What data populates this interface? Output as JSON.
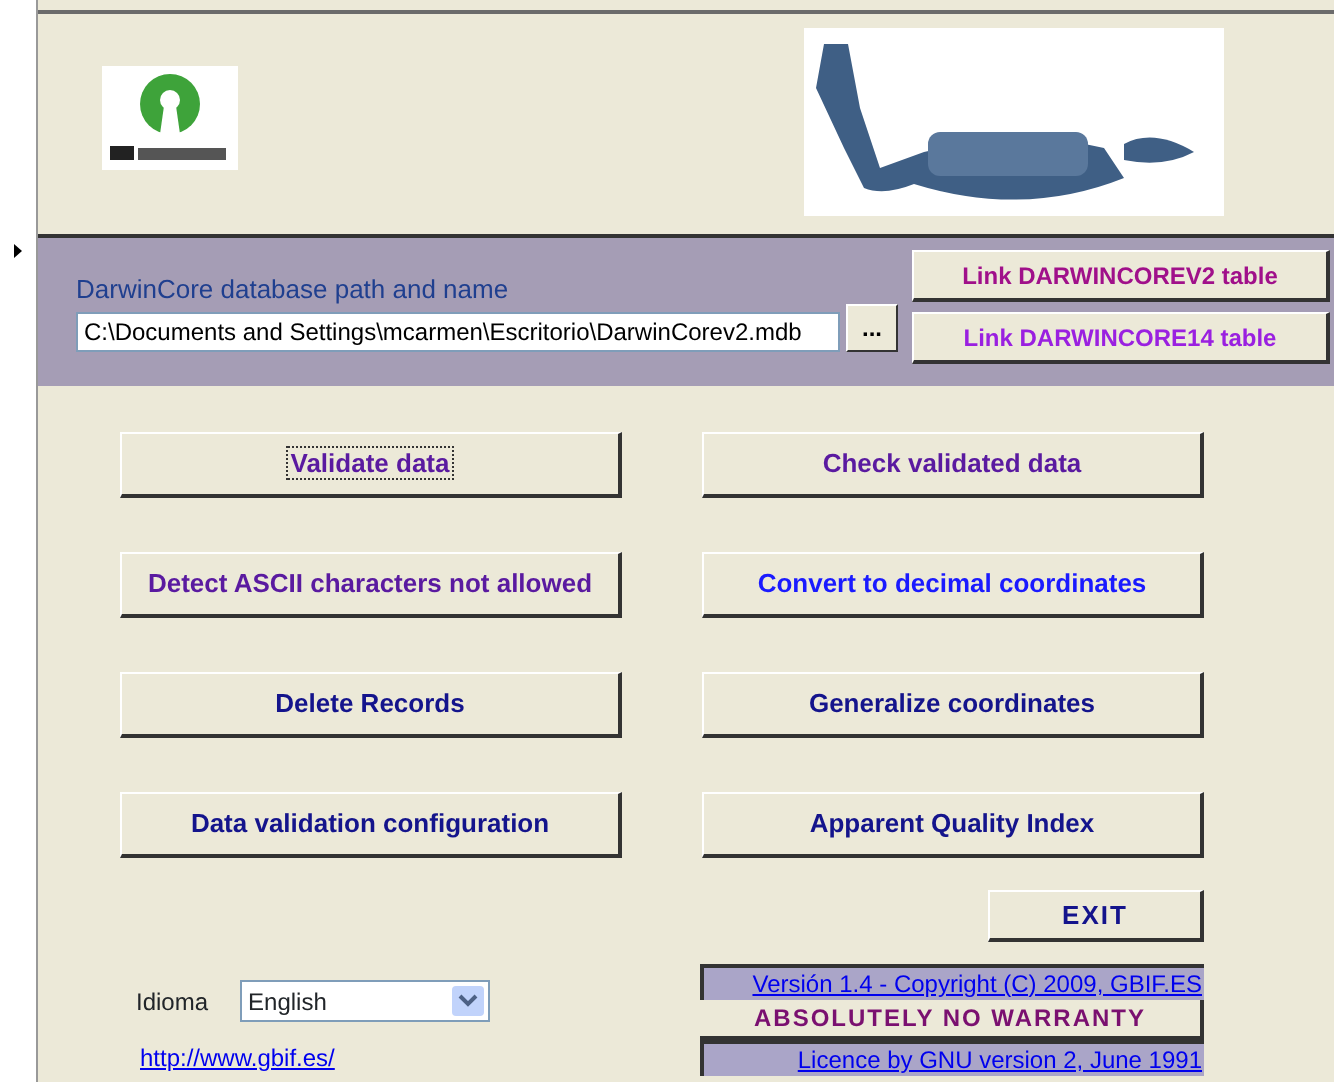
{
  "database": {
    "label": "DarwinCore database path and name",
    "path": "C:\\Documents and Settings\\mcarmen\\Escritorio\\DarwinCorev2.mdb",
    "browse": "..."
  },
  "link_buttons": [
    {
      "label": "Link DARWINCOREV2 table",
      "color": "#a0108a"
    },
    {
      "label": "Link DARWINCORE14 table",
      "color": "#9a20e0"
    }
  ],
  "actions": [
    {
      "label": "Validate data",
      "color": "#5a1aa0",
      "focused": true
    },
    {
      "label": "Check validated data",
      "color": "#5a1aa0",
      "focused": false
    },
    {
      "label": "Detect ASCII characters not allowed",
      "color": "#5a1aa0",
      "focused": false
    },
    {
      "label": "Convert to decimal coordinates",
      "color": "#1a1aff",
      "focused": false
    },
    {
      "label": "Delete Records",
      "color": "#14148c",
      "focused": false
    },
    {
      "label": "Generalize coordinates",
      "color": "#14148c",
      "focused": false
    },
    {
      "label": "Data validation configuration",
      "color": "#14148c",
      "focused": false
    },
    {
      "label": "Apparent Quality Index",
      "color": "#14148c",
      "focused": false
    }
  ],
  "exit": "EXIT",
  "language": {
    "label": "Idioma",
    "value": "English"
  },
  "website": "http://www.gbif.es/",
  "version": "Versión 1.4 - Copyright (C) 2009, GBIF.ES",
  "warranty": "ABSOLUTELY NO WARRANTY",
  "licence": "Licence by GNU version 2, June 1991"
}
